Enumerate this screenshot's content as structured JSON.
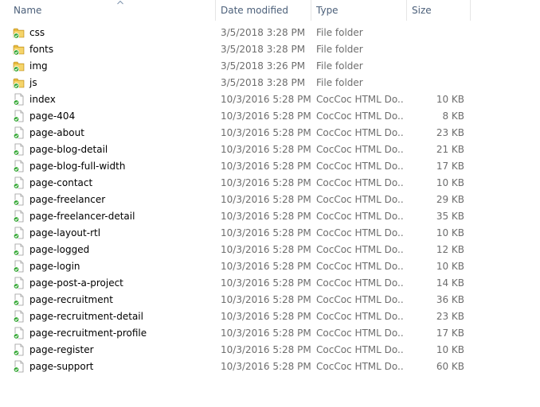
{
  "columns": {
    "name": "Name",
    "date_modified": "Date modified",
    "type": "Type",
    "size": "Size"
  },
  "sort": {
    "column": "name",
    "direction": "ascending",
    "icon": "sort-up-arrow-icon"
  },
  "icons": {
    "folder": "folder-sync-check-icon",
    "file": "html-file-sync-check-icon"
  },
  "colors": {
    "header_text": "#4c607a",
    "secondary_text": "#6d6d6d",
    "check": "#2fa52f",
    "folder": "#e6b83a"
  },
  "files": [
    {
      "name": "css",
      "date": "3/5/2018 3:28 PM",
      "type": "File folder",
      "size": "",
      "kind": "folder"
    },
    {
      "name": "fonts",
      "date": "3/5/2018 3:28 PM",
      "type": "File folder",
      "size": "",
      "kind": "folder"
    },
    {
      "name": "img",
      "date": "3/5/2018 3:26 PM",
      "type": "File folder",
      "size": "",
      "kind": "folder"
    },
    {
      "name": "js",
      "date": "3/5/2018 3:28 PM",
      "type": "File folder",
      "size": "",
      "kind": "folder"
    },
    {
      "name": "index",
      "date": "10/3/2016 5:28 PM",
      "type": "CocCoc HTML Do...",
      "size": "10 KB",
      "kind": "file"
    },
    {
      "name": "page-404",
      "date": "10/3/2016 5:28 PM",
      "type": "CocCoc HTML Do...",
      "size": "8 KB",
      "kind": "file"
    },
    {
      "name": "page-about",
      "date": "10/3/2016 5:28 PM",
      "type": "CocCoc HTML Do...",
      "size": "23 KB",
      "kind": "file"
    },
    {
      "name": "page-blog-detail",
      "date": "10/3/2016 5:28 PM",
      "type": "CocCoc HTML Do...",
      "size": "21 KB",
      "kind": "file"
    },
    {
      "name": "page-blog-full-width",
      "date": "10/3/2016 5:28 PM",
      "type": "CocCoc HTML Do...",
      "size": "17 KB",
      "kind": "file"
    },
    {
      "name": "page-contact",
      "date": "10/3/2016 5:28 PM",
      "type": "CocCoc HTML Do...",
      "size": "10 KB",
      "kind": "file"
    },
    {
      "name": "page-freelancer",
      "date": "10/3/2016 5:28 PM",
      "type": "CocCoc HTML Do...",
      "size": "29 KB",
      "kind": "file"
    },
    {
      "name": "page-freelancer-detail",
      "date": "10/3/2016 5:28 PM",
      "type": "CocCoc HTML Do...",
      "size": "35 KB",
      "kind": "file"
    },
    {
      "name": "page-layout-rtl",
      "date": "10/3/2016 5:28 PM",
      "type": "CocCoc HTML Do...",
      "size": "10 KB",
      "kind": "file"
    },
    {
      "name": "page-logged",
      "date": "10/3/2016 5:28 PM",
      "type": "CocCoc HTML Do...",
      "size": "12 KB",
      "kind": "file"
    },
    {
      "name": "page-login",
      "date": "10/3/2016 5:28 PM",
      "type": "CocCoc HTML Do...",
      "size": "10 KB",
      "kind": "file"
    },
    {
      "name": "page-post-a-project",
      "date": "10/3/2016 5:28 PM",
      "type": "CocCoc HTML Do...",
      "size": "14 KB",
      "kind": "file"
    },
    {
      "name": "page-recruitment",
      "date": "10/3/2016 5:28 PM",
      "type": "CocCoc HTML Do...",
      "size": "36 KB",
      "kind": "file"
    },
    {
      "name": "page-recruitment-detail",
      "date": "10/3/2016 5:28 PM",
      "type": "CocCoc HTML Do...",
      "size": "23 KB",
      "kind": "file"
    },
    {
      "name": "page-recruitment-profile",
      "date": "10/3/2016 5:28 PM",
      "type": "CocCoc HTML Do...",
      "size": "17 KB",
      "kind": "file"
    },
    {
      "name": "page-register",
      "date": "10/3/2016 5:28 PM",
      "type": "CocCoc HTML Do...",
      "size": "10 KB",
      "kind": "file"
    },
    {
      "name": "page-support",
      "date": "10/3/2016 5:28 PM",
      "type": "CocCoc HTML Do...",
      "size": "60 KB",
      "kind": "file"
    }
  ]
}
